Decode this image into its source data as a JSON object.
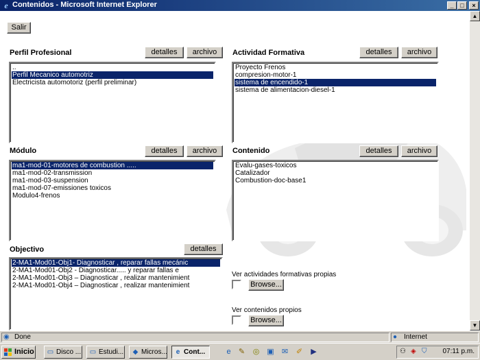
{
  "window": {
    "title": "Contenidos - Microsoft Internet Explorer"
  },
  "buttons": {
    "salir": "Salir",
    "detalles": "detalles",
    "archivo": "archivo",
    "browse": "Browse..."
  },
  "perfil": {
    "label": "Perfil Profesional",
    "items": [
      "..",
      "Perfil Mecanico automotriz",
      "Electricista automotoriz (perfil preliminar)"
    ],
    "selected_index": 1
  },
  "actividad": {
    "label": "Actividad Formativa",
    "items": [
      "Proyecto Frenos",
      "compresion-motor-1",
      "sistema de encendido-1",
      "sistema de alimentacion-diesel-1"
    ],
    "selected_index": 2
  },
  "modulo": {
    "label": "Módulo",
    "items": [
      "ma1-mod-01-motores de combustion .....",
      "ma1-mod-02-transmission",
      "ma1-mod-03-suspension",
      "ma1-mod-07-emissiones toxicos",
      "Modulo4-frenos"
    ],
    "selected_index": 0
  },
  "contenido": {
    "label": "Contenido",
    "items": [
      "Evalu-gases-toxicos",
      "Catalizador",
      "Combustion-doc-base1"
    ],
    "selected_index": -1
  },
  "objectivo": {
    "label": "Objectivo",
    "items": [
      "2-MA1-Mod01-Obj1- Diagnosticar , reparar fallas mecánic",
      "2-MA1-Mod01-Obj2 - Diagnosticar..... y reparar fallas e",
      "2-MA1-Mod01-Obj3 – Diagnosticar , realizar mantenimient",
      "2-MA1-Mod01-Obj4 – Diagnosticar , realizar mantenimient"
    ],
    "selected_index": 0
  },
  "ver_actividades": "Ver actividades formativas propias",
  "ver_contenidos": "Ver contenidos propios",
  "status": {
    "text": "Done",
    "zone": "Internet"
  },
  "taskbar": {
    "start": "Inicio",
    "tasks": [
      "Disco ...",
      "Estudi...",
      "Micros...",
      "Cont..."
    ],
    "clock": "07:11 p.m."
  }
}
